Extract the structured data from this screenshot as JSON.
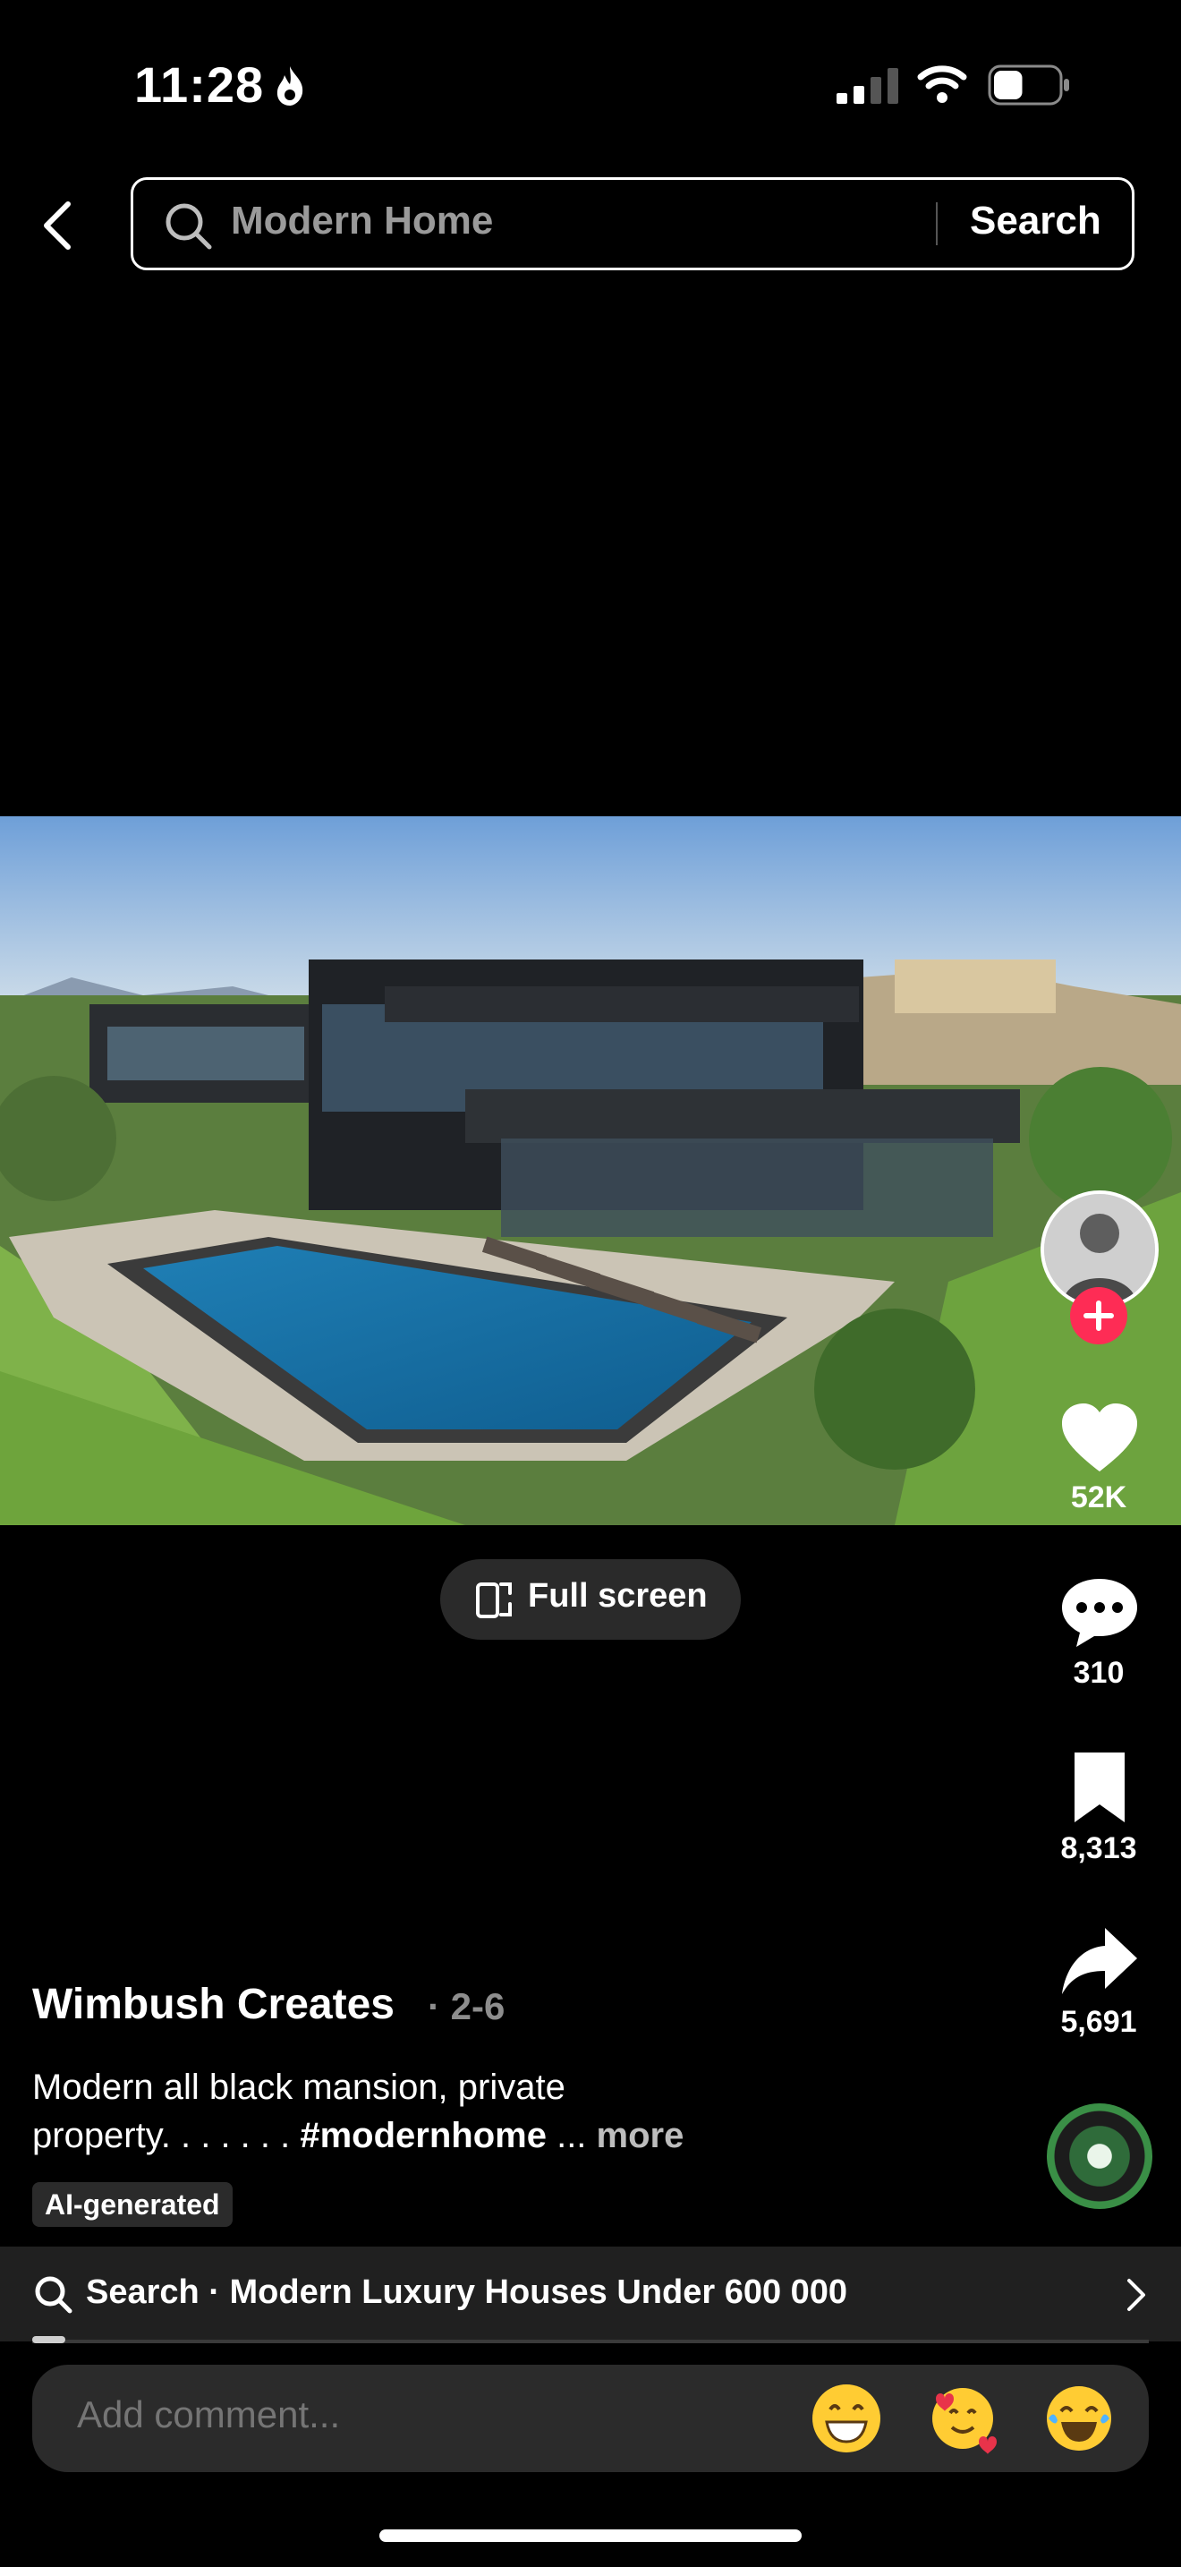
{
  "status_bar": {
    "time": "11:28",
    "battery_level": 0.45
  },
  "search": {
    "query": "Modern Home",
    "button_label": "Search"
  },
  "video": {
    "fullscreen_label": "Full screen"
  },
  "rail": {
    "likes": "52K",
    "comments": "310",
    "saves": "8,313",
    "shares": "5,691"
  },
  "caption": {
    "author": "Wimbush Creates",
    "date": "· 2-6",
    "line1": "Modern all black mansion, private",
    "line2_start": "property.  . . . . . . ",
    "hashtag": "#modernhome",
    "ellipsis": " ... ",
    "more": "more",
    "ai_badge": "AI-generated"
  },
  "suggestion": {
    "text": "Search · Modern Luxury Houses Under 600 000",
    "progress": 0.03
  },
  "comment": {
    "placeholder": "Add comment..."
  },
  "emojis": [
    "grinning-face-icon",
    "smiling-face-hearts-icon",
    "tears-of-joy-icon"
  ]
}
